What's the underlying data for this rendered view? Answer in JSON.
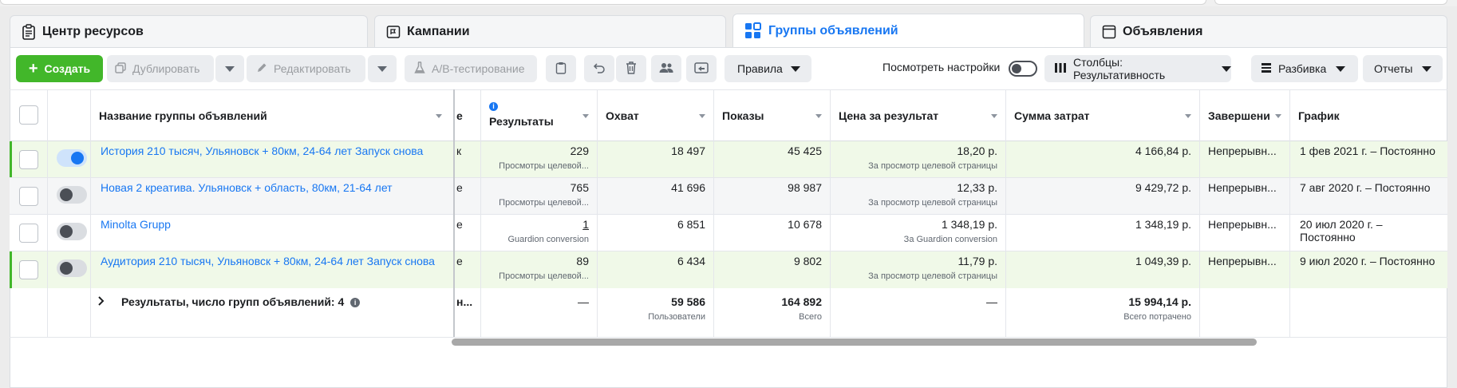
{
  "tabs": [
    {
      "label": "Центр ресурсов",
      "icon": "clipboard-icon"
    },
    {
      "label": "Кампании",
      "icon": "flag-icon"
    },
    {
      "label": "Группы объявлений",
      "icon": "grid-icon",
      "active": true
    },
    {
      "label": "Объявления",
      "icon": "window-icon"
    }
  ],
  "toolbar": {
    "create": "Создать",
    "duplicate": "Дублировать",
    "edit": "Редактировать",
    "ab_test": "A/B-тестирование",
    "rules": "Правила",
    "view_settings": "Посмотреть настройки",
    "columns": "Столбцы: Результативность",
    "breakdown": "Разбивка",
    "reports": "Отчеты"
  },
  "columns": {
    "name": "Название группы объявлений",
    "cut": "е",
    "results": "Результаты",
    "reach": "Охват",
    "impressions": "Показы",
    "cost": "Цена за результат",
    "spend": "Сумма затрат",
    "ends": "Завершени",
    "schedule": "График"
  },
  "rows": [
    {
      "name": "История 210 тысяч, Ульяновск + 80км, 24-64 лет Запуск снова",
      "cut": "к",
      "on": true,
      "results": "229",
      "results_sub": "Просмотры целевой...",
      "reach": "18 497",
      "impressions": "45 425",
      "cost": "18,20 р.",
      "cost_sub": "За просмотр целевой страницы",
      "spend": "4 166,84 р.",
      "ends": "Непрерывн...",
      "schedule": "1 фев 2021 г. – Постоянно"
    },
    {
      "name": "Новая 2 креатива. Ульяновск + область, 80км, 21-64 лет",
      "cut": "е",
      "on": false,
      "results": "765",
      "results_sub": "Просмотры целевой...",
      "reach": "41 696",
      "impressions": "98 987",
      "cost": "12,33 р.",
      "cost_sub": "За просмотр целевой страницы",
      "spend": "9 429,72 р.",
      "ends": "Непрерывн...",
      "schedule": "7 авг 2020 г. – Постоянно"
    },
    {
      "name": "Minolta Grupp",
      "cut": "е",
      "on": false,
      "results": "1",
      "results_sub": "Guardion conversion",
      "reach": "6 851",
      "impressions": "10 678",
      "cost": "1 348,19 р.",
      "cost_sub": "За Guardion conversion",
      "spend": "1 348,19 р.",
      "ends": "Непрерывн...",
      "schedule": "20 июл 2020 г. – Постоянно"
    },
    {
      "name": "Аудитория 210 тысяч, Ульяновск + 80км, 24-64 лет Запуск снова",
      "cut": "е",
      "on": false,
      "results": "89",
      "results_sub": "Просмотры целевой...",
      "reach": "6 434",
      "impressions": "9 802",
      "cost": "11,79 р.",
      "cost_sub": "За просмотр целевой страницы",
      "spend": "1 049,39 р.",
      "ends": "Непрерывн...",
      "schedule": "9 июл 2020 г. – Постоянно"
    }
  ],
  "totals": {
    "label": "Результаты, число групп объявлений: 4",
    "cut": "н...",
    "results": "—",
    "reach": "59 586",
    "reach_sub": "Пользователи",
    "impressions": "164 892",
    "impressions_sub": "Всего",
    "cost": "—",
    "spend": "15 994,14 р.",
    "spend_sub": "Всего потрачено"
  },
  "colors": {
    "accent": "#1877f2",
    "create_green": "#42b72a",
    "row_highlight": "#f0f9e8"
  }
}
